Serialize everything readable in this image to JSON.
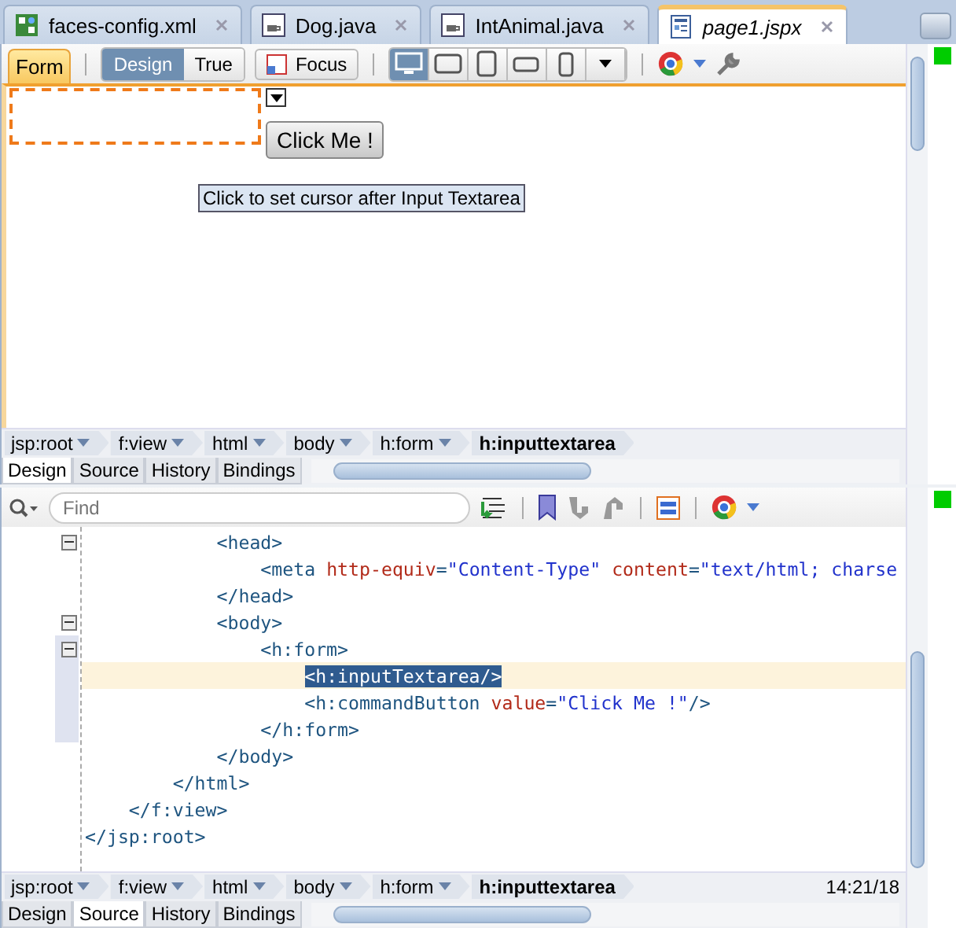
{
  "editor_tabs": [
    {
      "label": "faces-config.xml",
      "kind": "xml",
      "selected": false,
      "italic": false
    },
    {
      "label": "Dog.java",
      "kind": "java",
      "selected": false,
      "italic": false
    },
    {
      "label": "IntAnimal.java",
      "kind": "java",
      "selected": false,
      "italic": false
    },
    {
      "label": "page1.jspx",
      "kind": "page",
      "selected": true,
      "italic": true
    }
  ],
  "design": {
    "toolbar": {
      "form_tab": "Form",
      "view_modes": [
        {
          "label": "Design",
          "selected": true
        },
        {
          "label": "True",
          "selected": false
        }
      ],
      "focus": "Focus",
      "devices": [
        {
          "kind": "desktop",
          "selected": true
        },
        {
          "kind": "tablet-landscape",
          "selected": false
        },
        {
          "kind": "tablet",
          "selected": false
        },
        {
          "kind": "phone-landscape",
          "selected": false
        },
        {
          "kind": "phone",
          "selected": false
        }
      ]
    },
    "canvas": {
      "button": "Click Me !",
      "tooltip": "Click to set cursor after Input Textarea"
    },
    "breadcrumbs": [
      {
        "label": "jsp:root",
        "selected": false
      },
      {
        "label": "f:view",
        "selected": false
      },
      {
        "label": "html",
        "selected": false
      },
      {
        "label": "body",
        "selected": false
      },
      {
        "label": "h:form",
        "selected": false
      },
      {
        "label": "h:inputtextarea",
        "selected": true
      }
    ],
    "tabs": [
      {
        "label": "Design",
        "selected": true
      },
      {
        "label": "Source",
        "selected": false
      },
      {
        "label": "History",
        "selected": false
      },
      {
        "label": "Bindings",
        "selected": false
      }
    ]
  },
  "source": {
    "search": {
      "placeholder": "Find"
    },
    "code_lines": [
      {
        "fold": true,
        "current": false,
        "changed": false,
        "tokens": [
          {
            "kind": "tag",
            "text": "            <head>"
          }
        ]
      },
      {
        "fold": false,
        "current": false,
        "changed": false,
        "tokens": [
          {
            "kind": "tag",
            "text": "                <meta"
          },
          {
            "kind": "attr",
            "text": " http-equiv"
          },
          {
            "kind": "tag",
            "text": "="
          },
          {
            "kind": "value",
            "text": "\"Content-Type\""
          },
          {
            "kind": "attr",
            "text": " content"
          },
          {
            "kind": "tag",
            "text": "="
          },
          {
            "kind": "value",
            "text": "\"text/html; charse"
          }
        ]
      },
      {
        "fold": false,
        "current": false,
        "changed": false,
        "tokens": [
          {
            "kind": "tag",
            "text": "            </head>"
          }
        ]
      },
      {
        "fold": true,
        "current": false,
        "changed": false,
        "tokens": [
          {
            "kind": "tag",
            "text": "            <body>"
          }
        ]
      },
      {
        "fold": true,
        "current": false,
        "changed": true,
        "tokens": [
          {
            "kind": "tag",
            "text": "                <h:form>"
          }
        ]
      },
      {
        "fold": false,
        "current": true,
        "changed": true,
        "tokens": [
          {
            "kind": "tag",
            "text": "                    <h:inputTextarea/>",
            "selected": true
          }
        ]
      },
      {
        "fold": false,
        "current": false,
        "changed": true,
        "tokens": [
          {
            "kind": "tag",
            "text": "                    <h:commandButton"
          },
          {
            "kind": "attr",
            "text": " value"
          },
          {
            "kind": "tag",
            "text": "="
          },
          {
            "kind": "value",
            "text": "\"Click Me !\""
          },
          {
            "kind": "tag",
            "text": "/>"
          }
        ]
      },
      {
        "fold": false,
        "current": false,
        "changed": true,
        "tokens": [
          {
            "kind": "tag",
            "text": "                </h:form>"
          }
        ]
      },
      {
        "fold": false,
        "current": false,
        "changed": false,
        "tokens": [
          {
            "kind": "tag",
            "text": "            </body>"
          }
        ]
      },
      {
        "fold": false,
        "current": false,
        "changed": false,
        "tokens": [
          {
            "kind": "tag",
            "text": "        </html>"
          }
        ]
      },
      {
        "fold": false,
        "current": false,
        "changed": false,
        "tokens": [
          {
            "kind": "tag",
            "text": "    </f:view>"
          }
        ]
      },
      {
        "fold": false,
        "current": false,
        "changed": false,
        "tokens": [
          {
            "kind": "tag",
            "text": "</jsp:root>"
          }
        ]
      }
    ],
    "breadcrumbs": [
      {
        "label": "jsp:root",
        "selected": false
      },
      {
        "label": "f:view",
        "selected": false
      },
      {
        "label": "html",
        "selected": false
      },
      {
        "label": "body",
        "selected": false
      },
      {
        "label": "h:form",
        "selected": false
      },
      {
        "label": "h:inputtextarea",
        "selected": true
      }
    ],
    "position": "14:21/18",
    "tabs": [
      {
        "label": "Design",
        "selected": false
      },
      {
        "label": "Source",
        "selected": true
      },
      {
        "label": "History",
        "selected": false
      },
      {
        "label": "Bindings",
        "selected": false
      }
    ]
  }
}
